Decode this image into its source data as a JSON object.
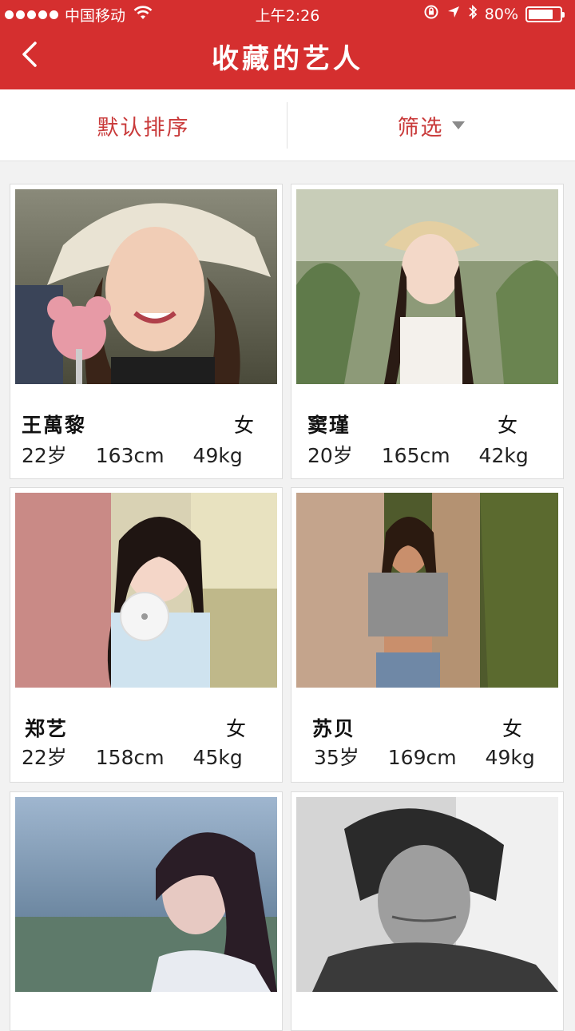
{
  "status_bar": {
    "carrier": "中国移动",
    "time": "上午2:26",
    "battery": "80%",
    "battery_level": 0.8
  },
  "header": {
    "title": "收藏的艺人",
    "back_icon": "chevron-left-icon"
  },
  "sort_bar": {
    "default_sort_label": "默认排序",
    "filter_label": "筛选"
  },
  "artists": [
    {
      "name": "王萬黎",
      "gender": "女",
      "age": "22岁",
      "height": "163cm",
      "weight": "49kg"
    },
    {
      "name": "窦瑾",
      "gender": "女",
      "age": "20岁",
      "height": "165cm",
      "weight": "42kg"
    },
    {
      "name": "郑艺",
      "gender": "女",
      "age": "22岁",
      "height": "158cm",
      "weight": "45kg"
    },
    {
      "name": "苏贝",
      "gender": "女",
      "age": "35岁",
      "height": "169cm",
      "weight": "49kg"
    },
    {
      "name": "",
      "gender": "",
      "age": "",
      "height": "",
      "weight": ""
    },
    {
      "name": "",
      "gender": "",
      "age": "",
      "height": "",
      "weight": ""
    }
  ],
  "colors": {
    "accent": "#d52f2f",
    "sort_text": "#c93a3a"
  }
}
